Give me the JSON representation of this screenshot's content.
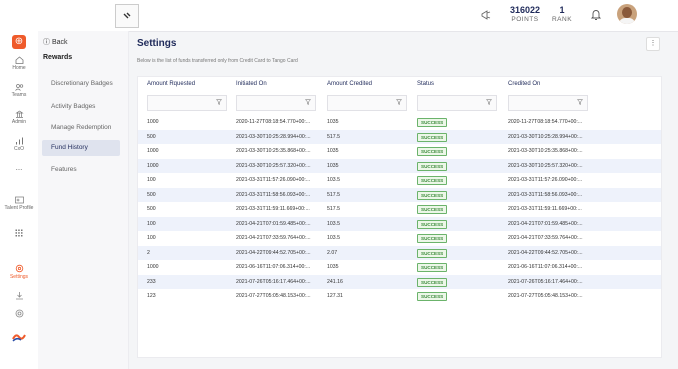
{
  "header": {
    "points_value": "316022",
    "points_label": "POINTS",
    "rank_value": "1",
    "rank_label": "RANK"
  },
  "rail": {
    "home_label": "Home",
    "teams_label": "Teams",
    "admin_label": "Admin",
    "cxo_label": "CxO",
    "more_label": "...",
    "talent_label": "Talent Profile",
    "settings_label": "Settings"
  },
  "subnav": {
    "back_label": "Back",
    "section_title": "Rewards",
    "items": [
      {
        "label": "Discretionary Badges"
      },
      {
        "label": "Activity Badges"
      },
      {
        "label": "Manage Redemption"
      },
      {
        "label": "Fund History"
      },
      {
        "label": "Features"
      }
    ]
  },
  "main": {
    "title": "Settings",
    "description": "Below is the list of funds transferred only from Credit Card to Tango Card"
  },
  "table": {
    "columns": [
      "Amount Rquested",
      "Initiated On",
      "Amount Credited",
      "Status",
      "Credited On"
    ],
    "rows": [
      [
        "1000",
        "2020-11-27T08:18:54.770+00:...",
        "1035",
        "SUCCESS",
        "2020-11-27T08:18:54.770+00:..."
      ],
      [
        "500",
        "2021-03-30T10:25:28.994+00:...",
        "517.5",
        "SUCCESS",
        "2021-03-30T10:25:28.994+00:..."
      ],
      [
        "1000",
        "2021-03-30T10:25:35.868+00:...",
        "1035",
        "SUCCESS",
        "2021-03-30T10:25:35.868+00:..."
      ],
      [
        "1000",
        "2021-03-30T10:25:57.320+00:...",
        "1035",
        "SUCCESS",
        "2021-03-30T10:25:57.320+00:..."
      ],
      [
        "100",
        "2021-03-31T11:57:26.090+00:...",
        "103.5",
        "SUCCESS",
        "2021-03-31T11:57:26.090+00:..."
      ],
      [
        "500",
        "2021-03-31T11:58:56.093+00:...",
        "517.5",
        "SUCCESS",
        "2021-03-31T11:58:56.093+00:..."
      ],
      [
        "500",
        "2021-03-31T11:59:11.669+00:...",
        "517.5",
        "SUCCESS",
        "2021-03-31T11:59:11.669+00:..."
      ],
      [
        "100",
        "2021-04-21T07:01:59.485+00:...",
        "103.5",
        "SUCCESS",
        "2021-04-21T07:01:59.485+00:..."
      ],
      [
        "100",
        "2021-04-21T07:33:59.764+00:...",
        "103.5",
        "SUCCESS",
        "2021-04-21T07:33:59.764+00:..."
      ],
      [
        "2",
        "2021-04-22T09:44:52.705+00:...",
        "2.07",
        "SUCCESS",
        "2021-04-22T09:44:52.705+00:..."
      ],
      [
        "1000",
        "2021-06-16T11:07:06.314+00:...",
        "1035",
        "SUCCESS",
        "2021-06-16T11:07:06.314+00:..."
      ],
      [
        "233",
        "2021-07-26T05:16:17.464+00:...",
        "241.16",
        "SUCCESS",
        "2021-07-26T05:16:17.464+00:..."
      ],
      [
        "123",
        "2021-07-27T05:05:48.153+00:...",
        "127.31",
        "SUCCESS",
        "2021-07-27T05:05:48.153+00:..."
      ]
    ]
  },
  "colors": {
    "accent": "#ef5b2b",
    "navy": "#1f2a5a",
    "success": "#3a8a3a",
    "row_alt": "#eef2fb"
  }
}
